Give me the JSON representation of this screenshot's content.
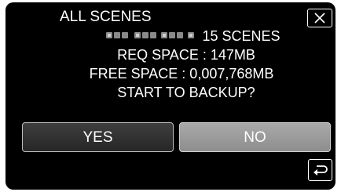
{
  "dialog": {
    "title": "ALL SCENES",
    "scenes_text": "15 SCENES",
    "req_space": "REQ SPACE : 147MB",
    "free_space": "FREE SPACE : 0,007,768MB",
    "prompt": "START TO BACKUP?"
  },
  "buttons": {
    "yes_label": "YES",
    "no_label": "NO"
  },
  "icons": {
    "close": "close-x-icon",
    "back": "return-arrow-icon",
    "date": "blurred-date-icon"
  },
  "colors": {
    "background": "#000000",
    "yes_button": "#2f2f2f",
    "no_button": "#9b9b9b",
    "text": "#ffffff"
  }
}
